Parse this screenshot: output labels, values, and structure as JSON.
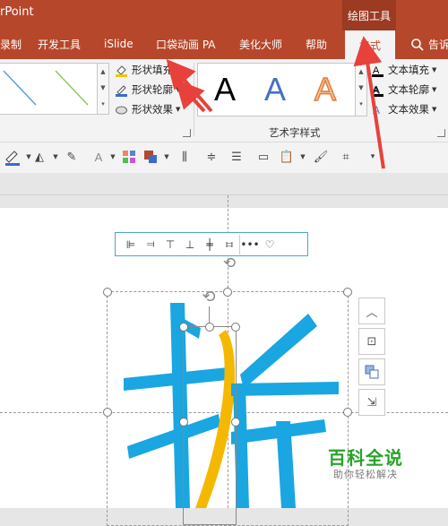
{
  "window": {
    "app_title": "rPoint",
    "tool_context": "绘图工具"
  },
  "tabs": [
    {
      "label": "录制"
    },
    {
      "label": "开发工具"
    },
    {
      "label": "iSlide"
    },
    {
      "label": "口袋动画 PA"
    },
    {
      "label": "美化大师"
    },
    {
      "label": "帮助"
    },
    {
      "label": "格式",
      "active": true
    }
  ],
  "search": {
    "label": "告诉"
  },
  "shape_styles": {
    "fill_label": "形状填充",
    "outline_label": "形状轮廓",
    "effects_label": "形状效果"
  },
  "wordart": {
    "group_label": "艺术字样式",
    "samples": [
      "A",
      "A",
      "A"
    ],
    "text_fill_label": "文本填充",
    "text_outline_label": "文本轮廓",
    "text_effects_label": "文本效果"
  },
  "watermark": {
    "title": "百科全说",
    "subtitle": "助你轻松解决"
  },
  "colors": {
    "ribbon_red": "#b7472a",
    "arrow_red": "#e8413b",
    "glyph_blue": "#1aa6e0",
    "glyph_yellow": "#f5b800",
    "watermark_green": "#29a329"
  },
  "icons": {
    "mini_toolbar": [
      "align-left-icon",
      "align-right-icon",
      "align-top-icon",
      "align-bottom-icon",
      "align-center-icon",
      "distribute-icon",
      "more-icon",
      "heart-icon"
    ],
    "side_panel": [
      "chevron-up-icon",
      "layout-options-icon",
      "arrange-icon",
      "resize-icon"
    ]
  }
}
